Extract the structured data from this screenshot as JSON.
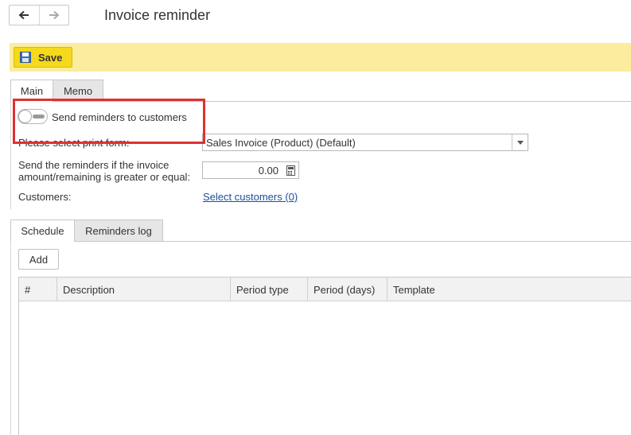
{
  "header": {
    "title": "Invoice reminder",
    "back_icon": "arrow-left-icon",
    "forward_icon": "arrow-right-icon"
  },
  "command_bar": {
    "save_label": "Save",
    "save_icon": "floppy-disk-icon",
    "bar_color": "#fbec9e",
    "button_color": "#f5d91a"
  },
  "main_tabs": [
    {
      "label": "Main",
      "active": true
    },
    {
      "label": "Memo",
      "active": false
    }
  ],
  "form": {
    "send_reminders": {
      "label": "Send reminders to customers",
      "checked": false
    },
    "print_form": {
      "label": "Please select print form:",
      "value": "Sales Invoice (Product) (Default)"
    },
    "threshold": {
      "label_line1": "Send the reminders if the invoice",
      "label_line2": "amount/remaining is greater or equal:",
      "value": "0.00"
    },
    "customers": {
      "label": "Customers:",
      "link_text": "Select customers (0)"
    }
  },
  "bottom_tabs": [
    {
      "label": "Schedule",
      "active": true
    },
    {
      "label": "Reminders log",
      "active": false
    }
  ],
  "schedule": {
    "add_label": "Add",
    "columns": [
      "#",
      "Description",
      "Period type",
      "Period (days)",
      "Template"
    ],
    "rows": []
  },
  "annotation_color": "#e03131",
  "link_color": "#1a4e9c"
}
